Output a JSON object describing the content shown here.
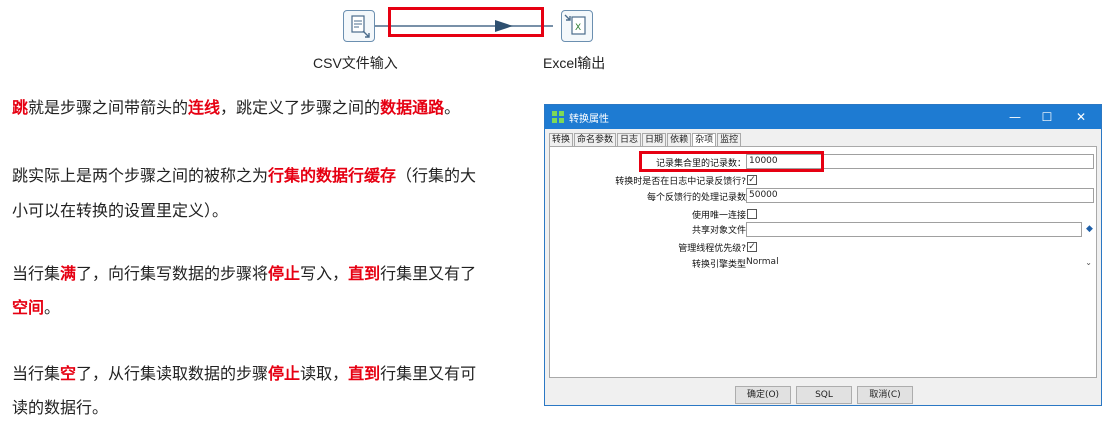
{
  "diagram": {
    "csv_step_label": "CSV文件输入",
    "excel_step_label": "Excel输出"
  },
  "article": {
    "p1": [
      {
        "t": "跳",
        "hl": true
      },
      {
        "t": "就是步骤之间带箭头的",
        "hl": false
      },
      {
        "t": "连线",
        "hl": true
      },
      {
        "t": "，跳定义了步骤之间的",
        "hl": false
      },
      {
        "t": "数据通路",
        "hl": true
      },
      {
        "t": "。",
        "hl": false
      }
    ],
    "p2_line1": [
      {
        "t": "跳实际上是两个步骤之间的被称之为",
        "hl": false
      },
      {
        "t": "行集的数据行缓存",
        "hl": true
      },
      {
        "t": "（行集的大",
        "hl": false
      }
    ],
    "p2_line2": [
      {
        "t": "小可以在转换的设置里定义）。",
        "hl": false
      }
    ],
    "p3_line1": [
      {
        "t": "当行集",
        "hl": false
      },
      {
        "t": "满",
        "hl": true
      },
      {
        "t": "了，向行集写数据的步骤将",
        "hl": false
      },
      {
        "t": "停止",
        "hl": true
      },
      {
        "t": "写入，",
        "hl": false
      },
      {
        "t": "直到",
        "hl": true
      },
      {
        "t": "行集里又有了",
        "hl": false
      }
    ],
    "p3_line2": [
      {
        "t": "空间",
        "hl": true
      },
      {
        "t": "。",
        "hl": false
      }
    ],
    "p4_line1": [
      {
        "t": "当行集",
        "hl": false
      },
      {
        "t": "空",
        "hl": true
      },
      {
        "t": "了，从行集读取数据的步骤",
        "hl": false
      },
      {
        "t": "停止",
        "hl": true
      },
      {
        "t": "读取，",
        "hl": false
      },
      {
        "t": "直到",
        "hl": true
      },
      {
        "t": "行集里又有可",
        "hl": false
      }
    ],
    "p4_line2": [
      {
        "t": "读的数据行。",
        "hl": false
      }
    ]
  },
  "dialog": {
    "title": "转换属性",
    "tabs": [
      "转换",
      "命名参数",
      "日志",
      "日期",
      "依赖",
      "杂项",
      "监控"
    ],
    "active_tab": "杂项",
    "fields": {
      "rowset_size_label": "记录集合里的记录数：",
      "rowset_size_value": "10000",
      "log_feedback_label": "转换时是否在日志中记录反馈行?",
      "feedback_size_label": "每个反馈行的处理记录数",
      "feedback_size_value": "50000",
      "unique_conn_label": "使用唯一连接",
      "shared_file_label": "共享对象文件",
      "shared_file_value": "",
      "thread_priority_label": "管理线程优先级?",
      "engine_type_label": "转换引擎类型",
      "engine_type_value": "Normal"
    },
    "buttons": {
      "ok": "确定(O)",
      "sql": "SQL",
      "cancel": "取消(C)"
    }
  },
  "colors": {
    "highlight": "#e60012",
    "titlebar": "#1e7bd2"
  }
}
